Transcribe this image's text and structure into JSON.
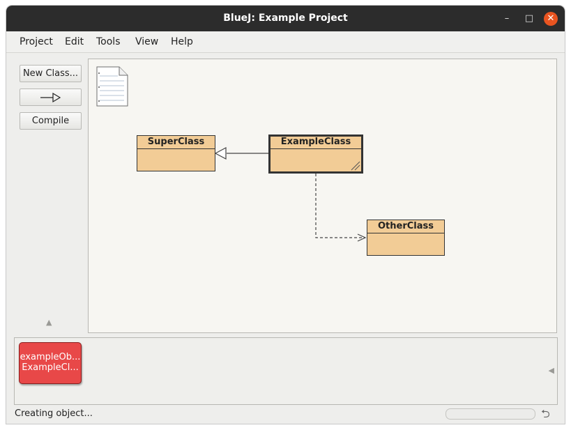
{
  "window": {
    "title": "BlueJ:  Example Project",
    "minimize": "–",
    "maximize": "□",
    "close": "✕"
  },
  "menu": [
    "Project",
    "Edit",
    "Tools",
    "View",
    "Help"
  ],
  "sidebar": {
    "new_class": "New Class...",
    "arrow_icon": "—▷",
    "compile": "Compile",
    "collapse_icon": "▲"
  },
  "diagram": {
    "readme_icon": "readme-document-icon",
    "classes": {
      "superclass": "SuperClass",
      "example": "ExampleClass",
      "other": "OtherClass"
    }
  },
  "object_bench": {
    "object": {
      "name": "exampleOb...",
      "type": "ExampleCl..."
    },
    "expand_icon": "◀"
  },
  "status": {
    "text": "Creating object...",
    "reset_icon": "⮌"
  },
  "colors": {
    "class_fill": "#f2cc96",
    "object_fill": "#e84848",
    "titlebar": "#2c2c2c",
    "close": "#e95420"
  }
}
